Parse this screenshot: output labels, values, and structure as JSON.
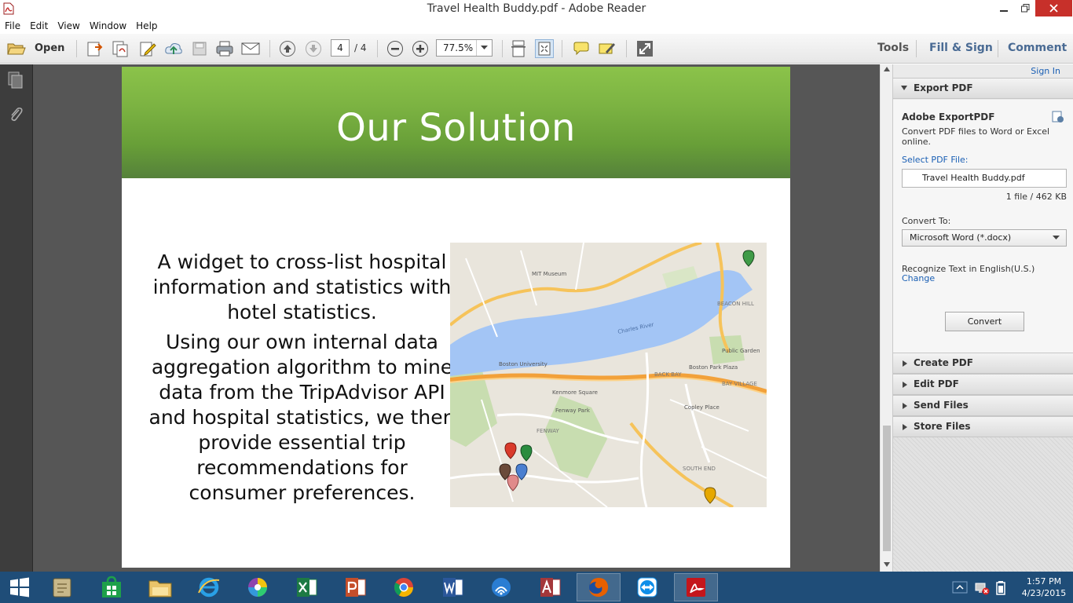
{
  "window": {
    "title": "Travel Health Buddy.pdf - Adobe Reader"
  },
  "menu": [
    "File",
    "Edit",
    "View",
    "Window",
    "Help"
  ],
  "toolbar": {
    "open_label": "Open",
    "page_current": "4",
    "page_total": "/ 4",
    "zoom": "77.5%",
    "tabs": {
      "tools": "Tools",
      "fill_sign": "Fill & Sign",
      "comment": "Comment"
    }
  },
  "slide": {
    "title": "Our Solution",
    "para1": "A widget to cross-list hospital information and statistics with hotel statistics.",
    "para2": "Using our own internal data aggregation algorithm to mine data from the TripAdvisor API and hospital statistics, we then provide essential trip recommendations for consumer preferences.",
    "map_labels": {
      "charles_river": "Charles River",
      "back_bay": "BACK BAY",
      "fenway": "FENWAY",
      "bay_village": "BAY VILLAGE",
      "south_end": "SOUTH END",
      "beacon_hill": "BEACON HILL",
      "boston_university": "Boston University",
      "kenmore": "Kenmore Square",
      "copley": "Copley Place",
      "public_garden": "Public Garden",
      "fenway_park": "Fenway Park",
      "mit_museum": "MIT Museum",
      "boston_park_plaza": "Boston Park Plaza"
    },
    "pin_colors": [
      "#d93a2b",
      "#2a8c3f",
      "#6b4a3a",
      "#4a7fd0",
      "#e08a8a",
      "#e6a800",
      "#3f9b47"
    ]
  },
  "right_pane": {
    "sign_in": "Sign In",
    "export_pdf": "Export PDF",
    "export_title": "Adobe ExportPDF",
    "export_desc": "Convert PDF files to Word or Excel online.",
    "select_label": "Select PDF File:",
    "file_name": "Travel Health Buddy.pdf",
    "file_info": "1 file / 462 KB",
    "convert_to_label": "Convert To:",
    "convert_to_value": "Microsoft Word (*.docx)",
    "recognize_text": "Recognize Text in English(U.S.)",
    "change_link": "Change",
    "convert_button": "Convert",
    "sections": [
      "Create PDF",
      "Edit PDF",
      "Send Files",
      "Store Files"
    ]
  },
  "taskbar": {
    "time": "1:57 PM",
    "date": "4/23/2015"
  },
  "colors": {
    "accent_blue": "#4a6b94",
    "slide_green": "#7cb342",
    "close_red": "#c7302a",
    "taskbar": "#1f4d78"
  }
}
